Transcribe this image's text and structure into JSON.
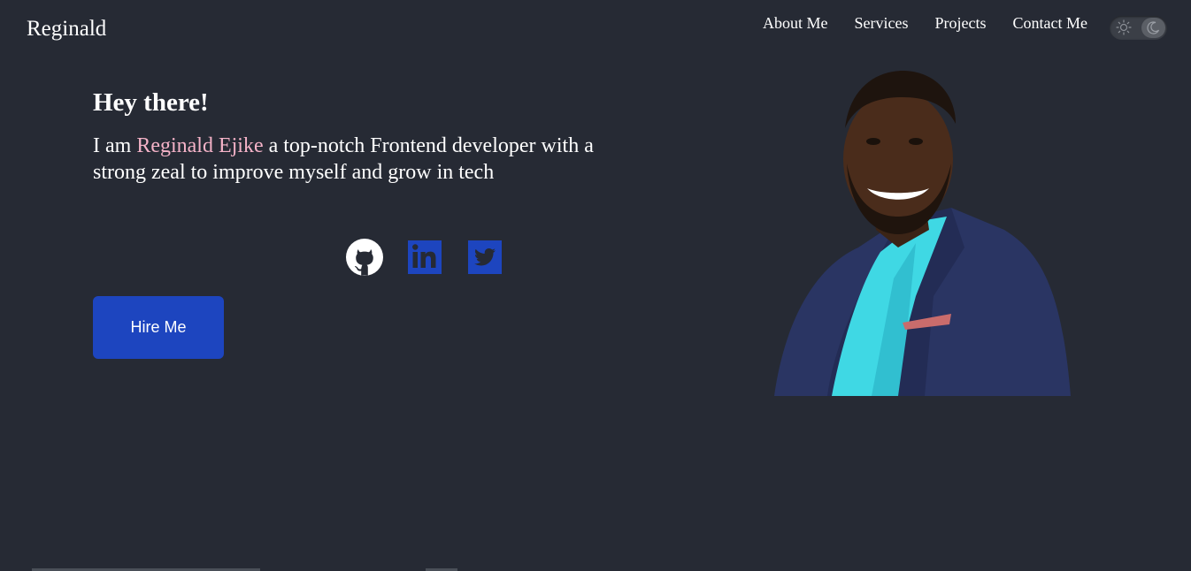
{
  "header": {
    "brand": "Reginald",
    "nav": [
      "About Me",
      "Services",
      "Projects",
      "Contact Me"
    ],
    "theme_toggle": {
      "icons": [
        "sun-icon",
        "moon-icon"
      ],
      "state": "dark"
    }
  },
  "hero": {
    "title": "Hey there!",
    "intro_prefix": "I am ",
    "name": "Reginald Ejike",
    "intro_suffix": " a top-notch Frontend developer with a strong zeal to improve myself and grow in tech",
    "button": "Hire Me"
  },
  "social": [
    "github-icon",
    "linkedin-icon",
    "twitter-icon"
  ],
  "colors": {
    "background": "#262a34",
    "accent": "#1d45bf",
    "highlight": "#f5b3c8",
    "text": "#ffffff"
  }
}
